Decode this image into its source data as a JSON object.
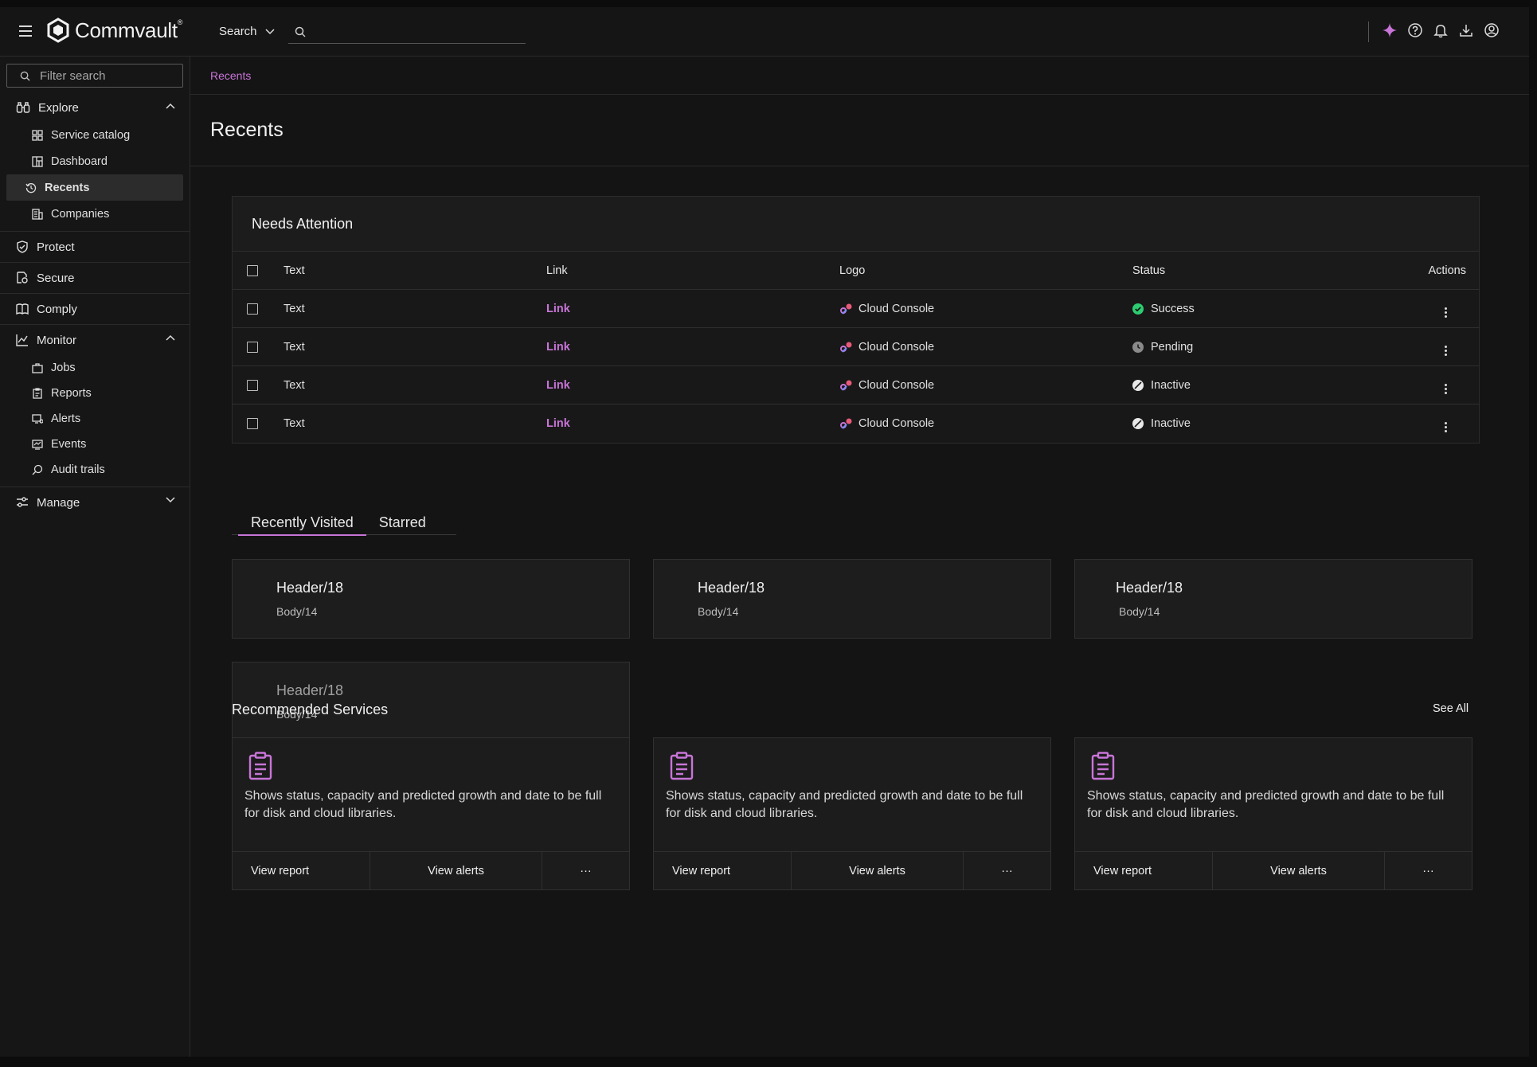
{
  "brand": {
    "name": "Commvault",
    "mark": "®"
  },
  "topbar": {
    "search_label": "Search",
    "search_placeholder": "",
    "icons": [
      "sparkle-icon",
      "help-icon",
      "bell-icon",
      "download-icon",
      "user-icon"
    ],
    "accent": "#c875d8"
  },
  "sidebar": {
    "filter_placeholder": "Filter search",
    "explore": {
      "label": "Explore",
      "items": [
        "Service catalog",
        "Dashboard",
        "Recents",
        "Companies"
      ]
    },
    "protect": "Protect",
    "secure": "Secure",
    "comply": "Comply",
    "monitor": {
      "label": "Monitor",
      "items": [
        "Jobs",
        "Reports",
        "Alerts",
        "Events",
        "Audit trails"
      ]
    },
    "manage": "Manage"
  },
  "breadcrumb": "Recents",
  "page_title": "Recents",
  "needs_attention": {
    "title": "Needs Attention",
    "columns": [
      "Text",
      "Link",
      "Logo",
      "Status",
      "Actions"
    ],
    "rows": [
      {
        "text": "Text",
        "link": "Link",
        "logo": "Cloud Console",
        "status": "Success"
      },
      {
        "text": "Text",
        "link": "Link",
        "logo": "Cloud Console",
        "status": "Pending"
      },
      {
        "text": "Text",
        "link": "Link",
        "logo": "Cloud Console",
        "status": "Inactive"
      },
      {
        "text": "Text",
        "link": "Link",
        "logo": "Cloud Console",
        "status": "Inactive"
      }
    ],
    "status_colors": {
      "success": "#2ecc71",
      "pending": "#8a8a8a",
      "inactive": "#e8e8e8"
    }
  },
  "tabs": [
    "Recently Visited",
    "Starred"
  ],
  "recent_cards": [
    {
      "header": "Header/18",
      "body": "Body/14"
    },
    {
      "header": "Header/18",
      "body": "Body/14"
    },
    {
      "header": "Header/18",
      "body": "Body/14"
    },
    {
      "header": "Header/18",
      "body": "Body/14"
    }
  ],
  "recommended": {
    "title": "Recommended Services",
    "see_all": "See All",
    "cards": [
      {
        "desc": "Shows status, capacity and predicted growth and date to be full for disk and cloud libraries.",
        "btn1": "View report",
        "btn2": "View alerts",
        "more": "···"
      },
      {
        "desc": "Shows status, capacity and predicted growth and date to be full for disk and cloud libraries.",
        "btn1": "View report",
        "btn2": "View alerts",
        "more": "···"
      },
      {
        "desc": "Shows status, capacity and predicted growth and date to be full for disk and cloud libraries.",
        "btn1": "View report",
        "btn2": "View alerts",
        "more": "···"
      }
    ]
  }
}
